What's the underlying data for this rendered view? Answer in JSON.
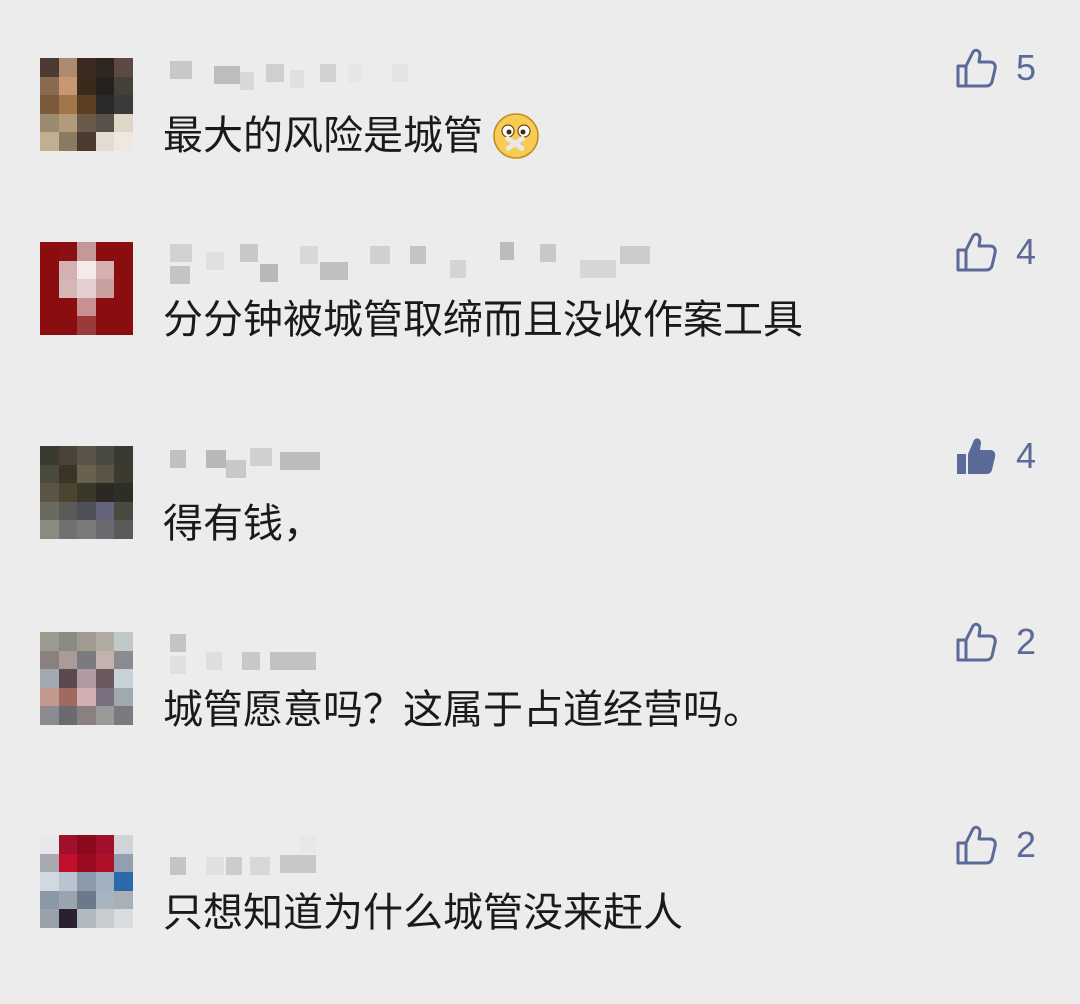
{
  "comments": [
    {
      "text": "最大的风险是城管",
      "emoji": "zipper-mouth-face-icon",
      "likes": "5",
      "liked": false,
      "avatar_colors": [
        "#4a3a33",
        "#b08a6e",
        "#3a2a20",
        "#2f2622",
        "#5a4a40",
        "#8a6a50",
        "#c89670",
        "#3a2a1c",
        "#24211e",
        "#45403a",
        "#7a5a3a",
        "#a27648",
        "#5c3e22",
        "#2a2a2a",
        "#3a3a3a",
        "#9a8a70",
        "#b29a7a",
        "#6a5a4a",
        "#5a5048",
        "#e0d6c8",
        "#c0b090",
        "#8a7a60",
        "#4a3a30",
        "#e4dcd0",
        "#efe8e0"
      ]
    },
    {
      "text": "分分钟被城管取缔而且没收作案工具",
      "emoji": "",
      "likes": "4",
      "liked": false,
      "avatar_colors": [
        "#8a0e10",
        "#8c1012",
        "#c49898",
        "#8a0e10",
        "#8a0e10",
        "#8a0e10",
        "#d4b0b0",
        "#f4eaea",
        "#d4b0b0",
        "#8a0e10",
        "#8a0e10",
        "#d4b6b6",
        "#e4d0d0",
        "#c8a0a0",
        "#8a0e10",
        "#8a0e10",
        "#8a0e10",
        "#c89090",
        "#8a0e10",
        "#8a0e10",
        "#8a0e10",
        "#8a0e10",
        "#9a3a3a",
        "#8a0e10",
        "#8a0e10"
      ]
    },
    {
      "text": "得有钱，",
      "emoji": "",
      "likes": "4",
      "liked": true,
      "avatar_colors": [
        "#3a3a30",
        "#4a4438",
        "#5a5448",
        "#4a4a40",
        "#3a3a34",
        "#4a4a3c",
        "#3a3428",
        "#6a6050",
        "#5a5444",
        "#3a3a30",
        "#5a5444",
        "#4a4430",
        "#3a3828",
        "#2a2a22",
        "#2e2e28",
        "#6a6a60",
        "#5a5a58",
        "#50505a",
        "#64647a",
        "#4a4a40",
        "#8a8a80",
        "#707070",
        "#7a7a78",
        "#6a6a70",
        "#5a5a5a"
      ]
    },
    {
      "text": "城管愿意吗？这属于占道经营吗。",
      "emoji": "",
      "likes": "2",
      "liked": false,
      "avatar_colors": [
        "#9a9a90",
        "#8a8a80",
        "#a09a90",
        "#b0aaa0",
        "#c0c8c8",
        "#8a8080",
        "#aa9a98",
        "#7a7a80",
        "#c2b2b0",
        "#8a8a90",
        "#a0aab0",
        "#5a4a50",
        "#b09aa0",
        "#6a5a60",
        "#c8d0d8",
        "#c09a90",
        "#a06a60",
        "#d0b0b0",
        "#7a7080",
        "#a0a8b0",
        "#8a8a90",
        "#6a6a70",
        "#8a8080",
        "#9a9a98",
        "#7a7a80"
      ]
    },
    {
      "text": "只想知道为什么城管没来赶人",
      "emoji": "",
      "likes": "2",
      "liked": false,
      "avatar_colors": [
        "#e8e8ec",
        "#a0102a",
        "#8a0a1c",
        "#a0102a",
        "#d0d4d8",
        "#a8aab0",
        "#c0102c",
        "#9a0a22",
        "#b0102a",
        "#90a0b0",
        "#d0d8e0",
        "#b8c4d0",
        "#8a9aaa",
        "#a0b0c0",
        "#2a6aaa",
        "#8a98a8",
        "#9aa4ae",
        "#6a7a8a",
        "#a8b4c0",
        "#aab0b8",
        "#9aa0a8",
        "#2a2030",
        "#b0b8c0",
        "#c8ccd0",
        "#d8dce0"
      ]
    }
  ]
}
